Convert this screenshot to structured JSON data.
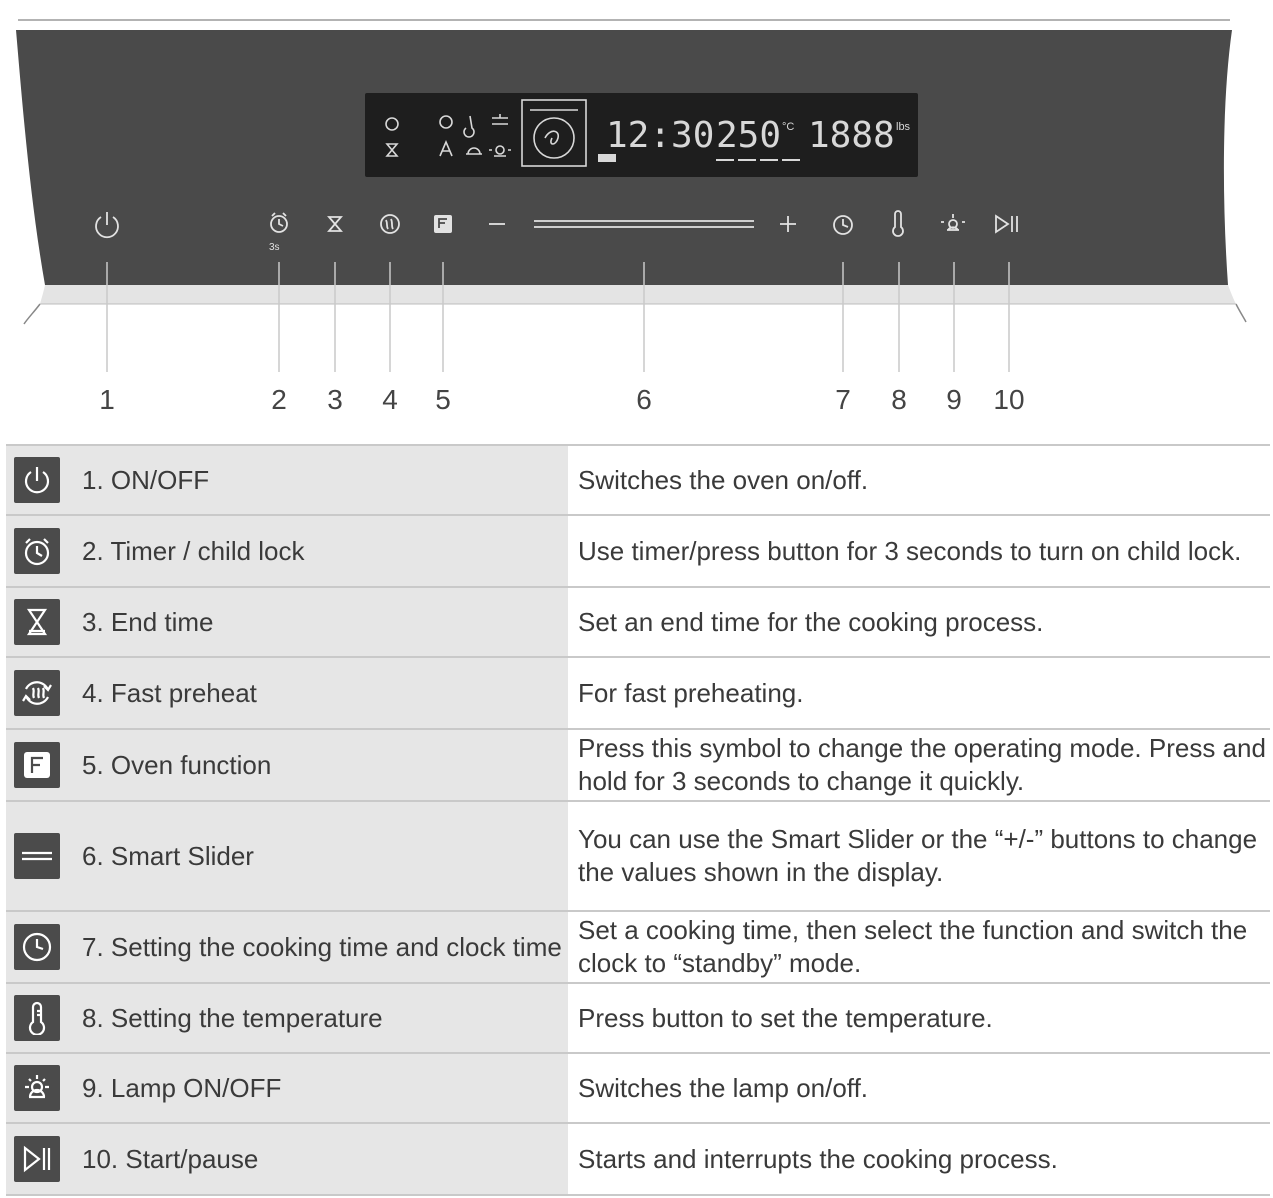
{
  "display": {
    "clock": "12:30",
    "temperature": "250",
    "weight": "1888",
    "temp_units": "°C",
    "weight_unit": "lbs"
  },
  "panel_buttons": [
    {
      "number": "1",
      "icon": "power-icon"
    },
    {
      "number": "2",
      "icon": "alarm-clock-icon",
      "sub_label": "3s"
    },
    {
      "number": "3",
      "icon": "hourglass-icon"
    },
    {
      "number": "4",
      "icon": "fast-preheat-icon"
    },
    {
      "number": "5",
      "icon": "function-f-icon"
    },
    {
      "number": "6",
      "icon": "slider-icon",
      "minus": "−",
      "plus": "+"
    },
    {
      "number": "7",
      "icon": "clock-icon"
    },
    {
      "number": "8",
      "icon": "thermometer-icon"
    },
    {
      "number": "9",
      "icon": "lamp-icon"
    },
    {
      "number": "10",
      "icon": "play-pause-icon"
    }
  ],
  "controls": [
    {
      "icon": "power-icon",
      "name": "1. ON/OFF",
      "description": "Switches the oven on/off."
    },
    {
      "icon": "alarm-clock-icon",
      "name": "2. Timer / child lock",
      "description": "Use timer/press button for 3 seconds to turn on child lock."
    },
    {
      "icon": "hourglass-icon",
      "name": "3. End time",
      "description": "Set an end time for the cooking process."
    },
    {
      "icon": "fast-preheat-icon",
      "name": "4. Fast preheat",
      "description": "For fast preheating."
    },
    {
      "icon": "function-f-icon",
      "name": "5. Oven function",
      "description": "Press this symbol to change the operating mode. Press and hold for 3 seconds to change it quickly."
    },
    {
      "icon": "slider-icon",
      "name": "6. Smart Slider",
      "description": "You can use the Smart Slider or the “+/-” buttons to change the values shown in the display."
    },
    {
      "icon": "clock-icon",
      "name": "7. Setting the cooking time and clock time",
      "description": "Set a cooking time, then select the function and switch the clock to “standby” mode."
    },
    {
      "icon": "thermometer-icon",
      "name": "8. Setting the temperature",
      "description": "Press button to set the temperature."
    },
    {
      "icon": "lamp-icon",
      "name": "9. Lamp ON/OFF",
      "description": "Switches the lamp on/off."
    },
    {
      "icon": "play-pause-icon",
      "name": "10. Start/pause",
      "description": "Starts and interrupts the cooking process."
    }
  ]
}
